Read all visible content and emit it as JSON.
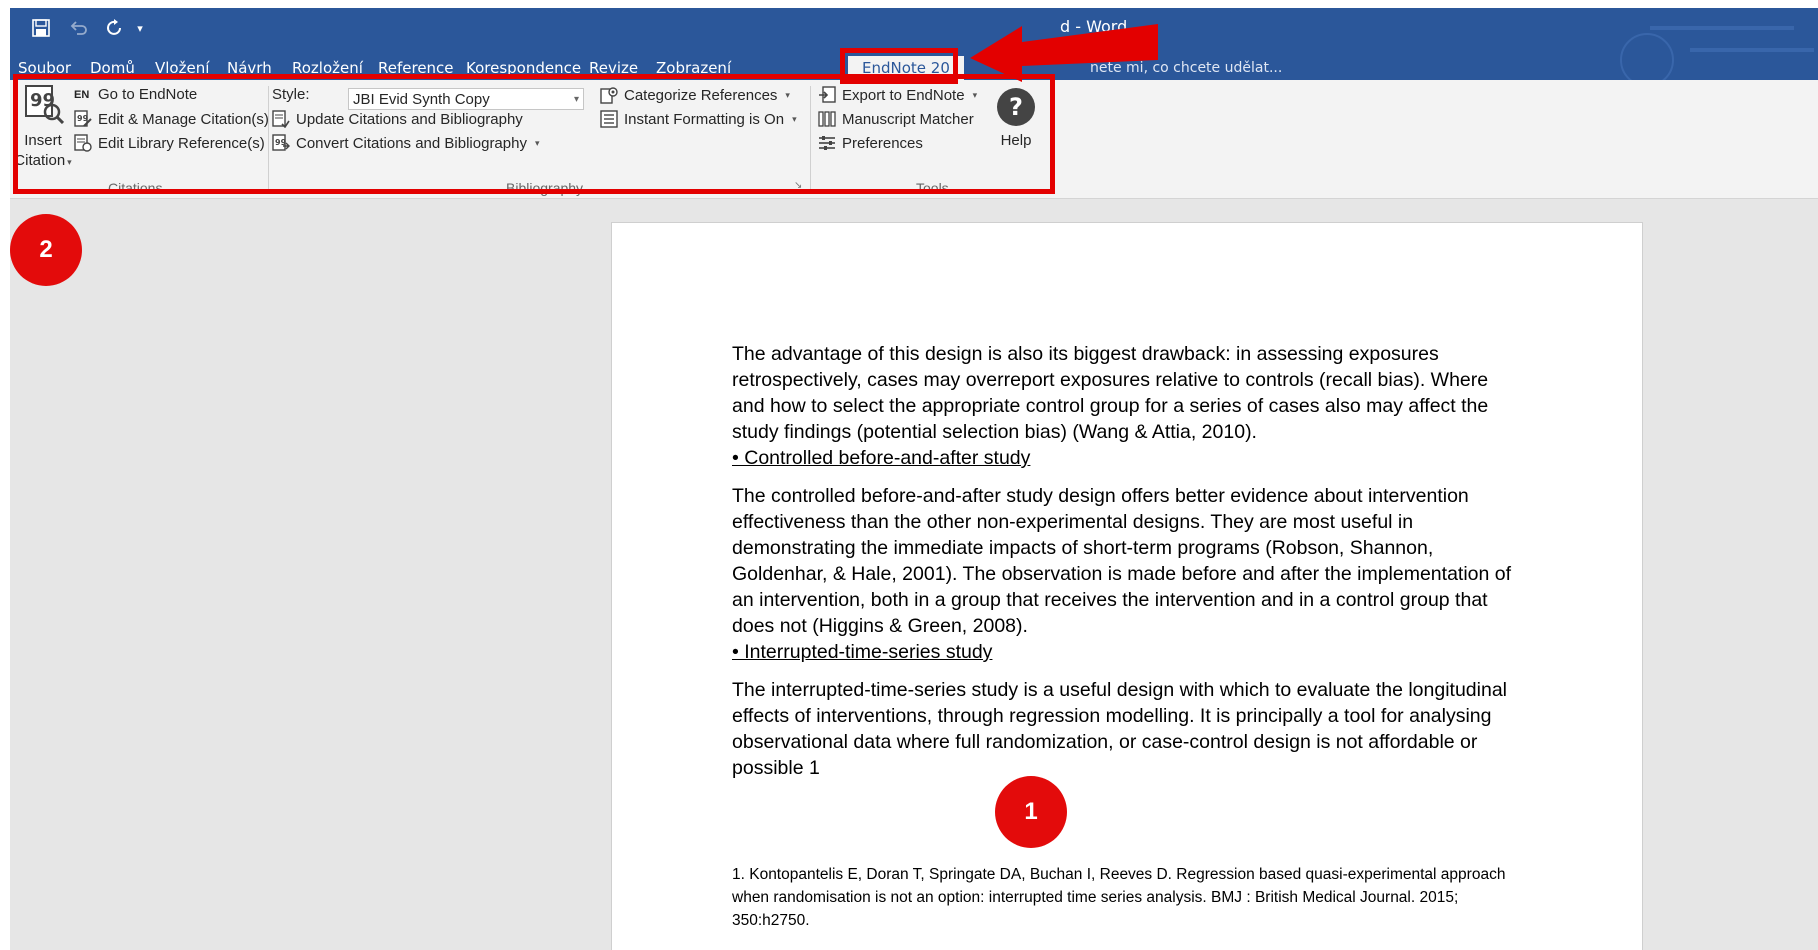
{
  "window": {
    "title": "d - Word",
    "accent": "#2b579a",
    "annotation_color": "#e30000"
  },
  "tabs": [
    {
      "label": "Soubor"
    },
    {
      "label": "Domů"
    },
    {
      "label": "Vložení"
    },
    {
      "label": "Návrh"
    },
    {
      "label": "Rozložení"
    },
    {
      "label": "Reference"
    },
    {
      "label": "Korespondence"
    },
    {
      "label": "Revize"
    },
    {
      "label": "Zobrazení"
    },
    {
      "label": "EndNote 20",
      "active": true
    }
  ],
  "tell_me": "nete mi, co chcete udělat...",
  "ribbon": {
    "citations": {
      "insert_label_1": "Insert",
      "insert_label_2": "Citation",
      "go_to": "Go to EndNote",
      "go_to_icon_text": "EN",
      "edit_manage": "Edit & Manage Citation(s)",
      "edit_library": "Edit Library Reference(s)",
      "group": "Citations"
    },
    "bibliography": {
      "style_label": "Style:",
      "style_value": "JBI Evid Synth Copy",
      "update": "Update Citations and Bibliography",
      "convert": "Convert Citations and Bibliography",
      "categorize": "Categorize References",
      "instant": "Instant Formatting is On",
      "group": "Bibliography"
    },
    "tools": {
      "export": "Export to EndNote",
      "matcher": "Manuscript Matcher",
      "preferences": "Preferences",
      "help": "Help",
      "group": "Tools"
    }
  },
  "badges": {
    "one": "1",
    "two": "2"
  },
  "document": {
    "p1": "The advantage of this design is also its biggest drawback: in assessing exposures retrospectively, cases may overreport exposures relative to controls (recall bias). Where and how to select the appropriate control group for a series of cases also may affect the study findings (potential selection bias) (Wang & Attia, 2010).",
    "b1": "• Controlled before-and-after study",
    "p2a": "The controlled before-and-after study design offers better evidence about intervention",
    "p2b": "effectiveness than the other non-experimental designs. They are most useful in demonstrating the immediate impacts of short-term programs (Robson, Shannon, Goldenhar, & Hale, 2001). The observation is made before and after the implementation of an intervention, both in a group that receives the intervention and in a control group that does not (Higgins & Green, 2008).",
    "b2": "• Interrupted-time-series study",
    "p3": "The interrupted-time-series study is a useful design with which to evaluate the longitudinal effects of interventions, through regression modelling. It is principally a tool for analysing observational data where full randomization, or case-control design is not affordable or possible 1",
    "footnote": "1. Kontopantelis E, Doran T, Springate DA, Buchan I, Reeves D. Regression based quasi-experimental approach when randomisation is not an option: interrupted time series analysis. BMJ : British Medical Journal. 2015; 350:h2750."
  }
}
